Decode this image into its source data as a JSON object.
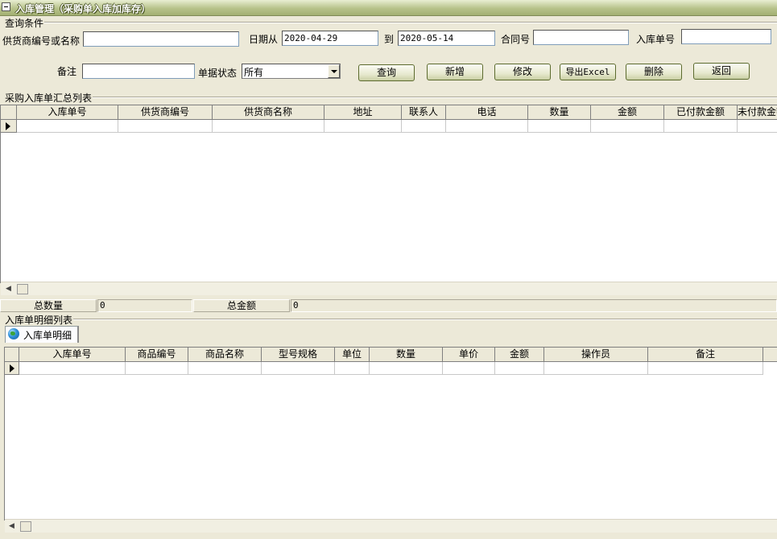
{
  "window": {
    "title": "入库管理（采购单入库加库存）"
  },
  "query": {
    "group_title": "查询条件",
    "supplier_label": "供货商编号或名称",
    "supplier_value": "",
    "date_from_label": "日期从",
    "date_from_value": "2020-04-29",
    "date_to_label": "到",
    "date_to_value": "2020-05-14",
    "contract_label": "合同号",
    "contract_value": "",
    "inbound_no_label": "入库单号",
    "inbound_no_value": "",
    "remark_label": "备注",
    "remark_value": "",
    "status_label": "单据状态",
    "status_value": "所有"
  },
  "buttons": {
    "query": "查询",
    "add": "新增",
    "edit": "修改",
    "export": "导出Excel",
    "delete": "删除",
    "back": "返回"
  },
  "summary_grid": {
    "group_title": "采购入库单汇总列表",
    "columns": [
      "入库单号",
      "供货商编号",
      "供货商名称",
      "地址",
      "联系人",
      "电话",
      "数量",
      "金额",
      "已付款金额",
      "未付款金额"
    ]
  },
  "totals": {
    "qty_label": "总数量",
    "qty_value": "0",
    "amount_label": "总金额",
    "amount_value": "0"
  },
  "detail": {
    "group_title": "入库单明细列表",
    "tab_label": "入库单明细",
    "columns": [
      "入库单号",
      "商品编号",
      "商品名称",
      "型号规格",
      "单位",
      "数量",
      "单价",
      "金额",
      "操作员",
      "备注"
    ]
  },
  "icons": {
    "window_menu": "window-menu-icon",
    "tab": "globe-icon",
    "row_indicator": "row-pointer-icon",
    "scroll_left": "scroll-left-arrow-icon",
    "combo": "dropdown-arrow-icon"
  }
}
